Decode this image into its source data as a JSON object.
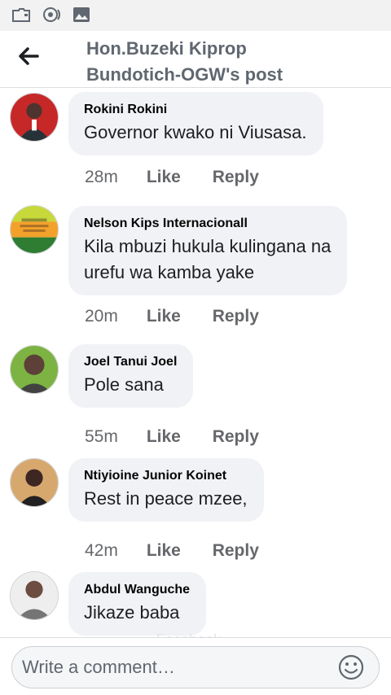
{
  "status_bar": {
    "icons": [
      "briefcase-icon",
      "radio-icon",
      "image-icon"
    ]
  },
  "header": {
    "title_line1": "Hon.Buzeki Kiprop",
    "title_line2": "Bundotich-OGW's post",
    "back_icon": "arrow-left-icon"
  },
  "comments": [
    {
      "author": "Rokini Rokini",
      "text_lines": [
        "Governor kwako ni Viusasa."
      ],
      "time": "28m",
      "like": "Like",
      "reply": "Reply"
    },
    {
      "author": "Nelson Kips Internacionall",
      "text_lines": [
        "Kila mbuzi hukula kulingana na",
        "urefu wa kamba yake"
      ],
      "time": "20m",
      "like": "Like",
      "reply": "Reply"
    },
    {
      "author": "Joel Tanui Joel",
      "text_lines": [
        "Pole sana"
      ],
      "time": "55m",
      "like": "Like",
      "reply": "Reply"
    },
    {
      "author": "Ntiyioine Junior Koinet",
      "text_lines": [
        "Rest in peace mzee,"
      ],
      "time": "42m",
      "like": "Like",
      "reply": "Reply"
    },
    {
      "author": "Abdul Wanguche",
      "text_lines": [
        "Jikaze baba"
      ]
    }
  ],
  "watermark": "Facebook",
  "composer": {
    "placeholder": "Write a comment…",
    "emoji_icon": "smiley-icon"
  },
  "colors": {
    "bubble": "#f0f2f5",
    "meta_text": "#65676b",
    "header_text": "#606770",
    "status_bar": "#f2f2f2"
  }
}
